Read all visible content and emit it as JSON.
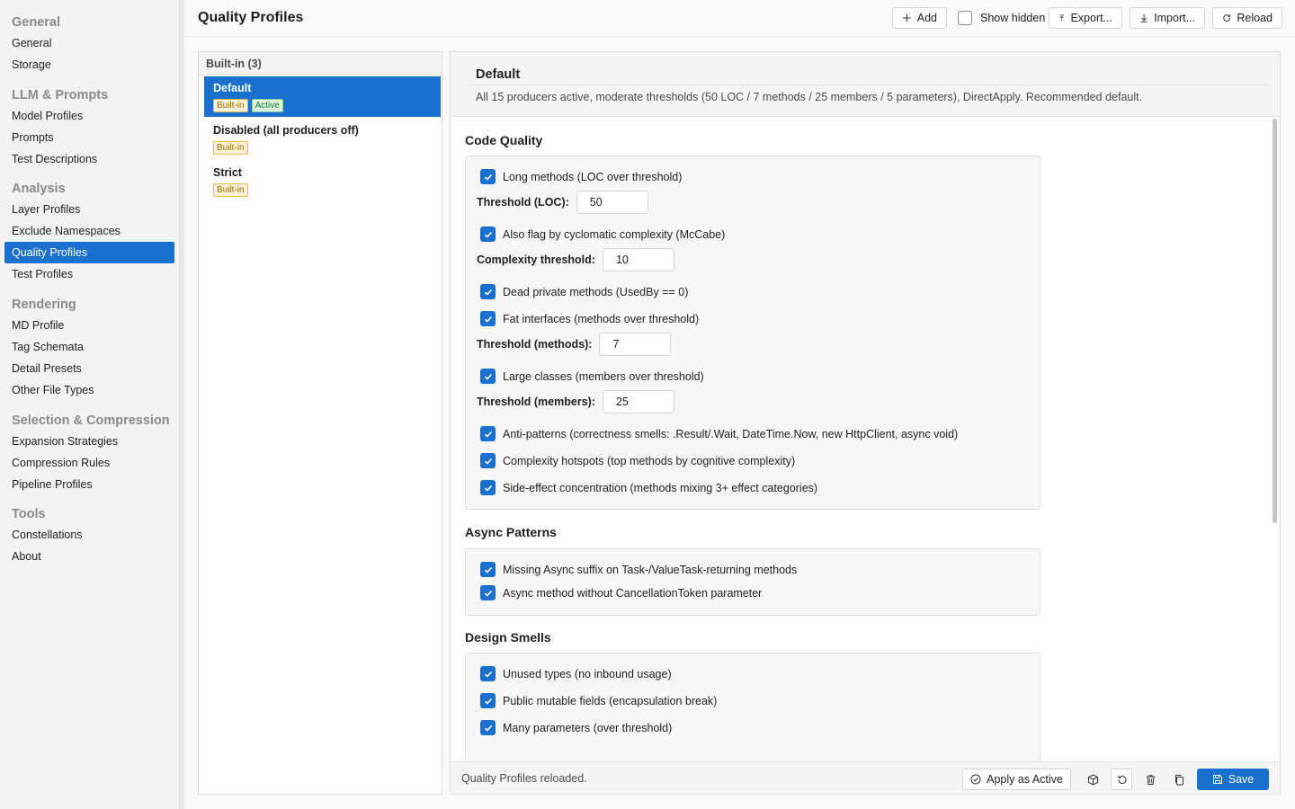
{
  "sidebar": {
    "groups": [
      {
        "header": "General",
        "items": [
          "General",
          "Storage"
        ]
      },
      {
        "header": "LLM & Prompts",
        "items": [
          "Model Profiles",
          "Prompts",
          "Test Descriptions"
        ]
      },
      {
        "header": "Analysis",
        "items": [
          "Layer Profiles",
          "Exclude Namespaces",
          "Quality Profiles",
          "Test Profiles"
        ]
      },
      {
        "header": "Rendering",
        "items": [
          "MD Profile",
          "Tag Schemata",
          "Detail Presets",
          "Other File Types"
        ]
      },
      {
        "header": "Selection & Compression",
        "items": [
          "Expansion Strategies",
          "Compression Rules",
          "Pipeline Profiles"
        ]
      },
      {
        "header": "Tools",
        "items": [
          "Constellations",
          "About"
        ]
      }
    ],
    "selected": "Quality Profiles"
  },
  "toolbar": {
    "title": "Quality Profiles",
    "add_label": "Add",
    "show_hidden_label": "Show hidden",
    "export_label": "Export...",
    "import_label": "Import...",
    "reload_label": "Reload"
  },
  "profiles": {
    "group_header": "Built-in (3)",
    "items": [
      {
        "name": "Default",
        "badges": [
          "Built-in",
          "Active"
        ]
      },
      {
        "name": "Disabled (all producers off)",
        "badges": [
          "Built-in"
        ]
      },
      {
        "name": "Strict",
        "badges": [
          "Built-in"
        ]
      }
    ]
  },
  "detail": {
    "title": "Default",
    "description": "All 15 producers active, moderate thresholds (50 LOC / 7 methods / 25 members / 5 parameters), DirectApply. Recommended default.",
    "sections": {
      "code_quality": {
        "title": "Code Quality",
        "long_methods": "Long methods (LOC over threshold)",
        "threshold_loc_label": "Threshold (LOC):",
        "threshold_loc": "50",
        "cyclomatic": "Also flag by cyclomatic complexity (McCabe)",
        "complexity_label": "Complexity threshold:",
        "complexity": "10",
        "dead_private": "Dead private methods (UsedBy == 0)",
        "fat_interfaces": "Fat interfaces (methods over threshold)",
        "threshold_methods_label": "Threshold (methods):",
        "threshold_methods": "7",
        "large_classes": "Large classes (members over threshold)",
        "threshold_members_label": "Threshold (members):",
        "threshold_members": "25",
        "anti_patterns": "Anti-patterns (correctness smells: .Result/.Wait, DateTime.Now, new HttpClient, async void)",
        "hotspots": "Complexity hotspots (top methods by cognitive complexity)",
        "side_effect": "Side-effect concentration (methods mixing 3+ effect categories)"
      },
      "async_patterns": {
        "title": "Async Patterns",
        "missing_suffix": "Missing Async suffix on Task-/ValueTask-returning methods",
        "no_cancellation": "Async method without CancellationToken parameter"
      },
      "design_smells": {
        "title": "Design Smells",
        "unused_types": "Unused types (no inbound usage)",
        "public_mutable": "Public mutable fields (encapsulation break)",
        "many_params": "Many parameters (over threshold)"
      }
    }
  },
  "footer": {
    "status": "Quality Profiles reloaded.",
    "apply_label": "Apply as Active",
    "save_label": "Save"
  },
  "colors": {
    "accent": "#1a70cf",
    "builtin_badge": "#e6b94a",
    "active_badge": "#8ccf9c"
  }
}
